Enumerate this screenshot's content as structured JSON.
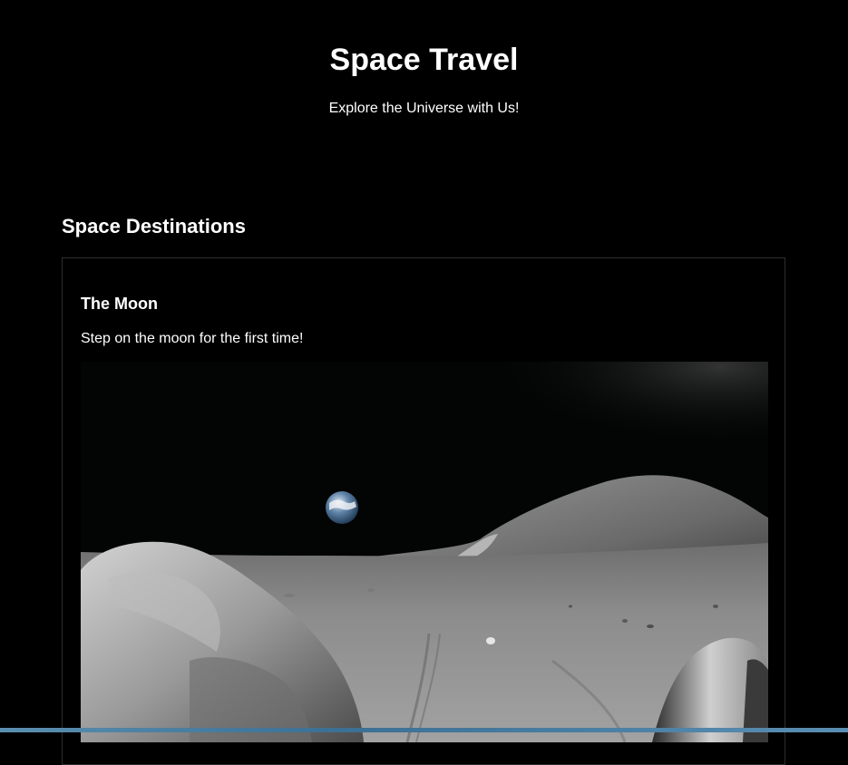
{
  "header": {
    "title": "Space Travel",
    "tagline": "Explore the Universe with Us!"
  },
  "destinations": {
    "heading": "Space Destinations",
    "cards": [
      {
        "title": "The Moon",
        "description": "Step on the moon for the first time!",
        "image_subject": "earthrise-over-lunar-surface"
      }
    ]
  },
  "colors": {
    "background": "#000000",
    "text": "#ffffff",
    "card_border": "#2e2e2e",
    "bottom_bar": "#4a7fa3"
  }
}
